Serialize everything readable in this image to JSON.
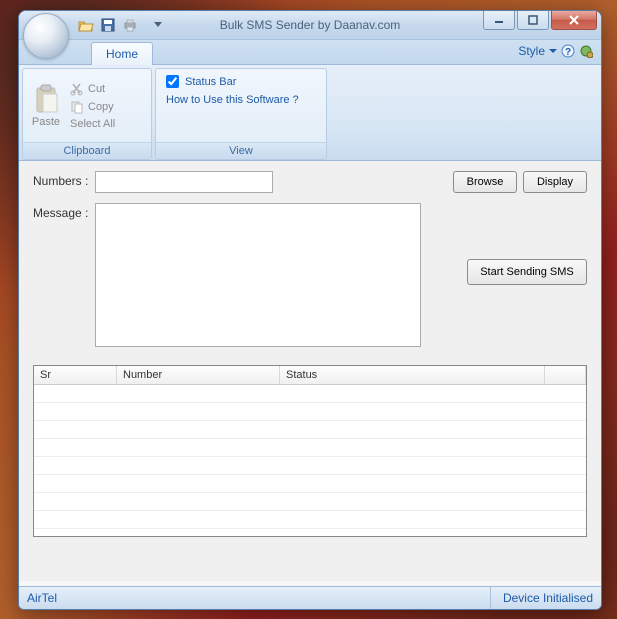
{
  "title": "Bulk SMS Sender by Daanav.com",
  "style_label": "Style",
  "tabs": {
    "home": "Home"
  },
  "ribbon": {
    "clipboard": {
      "label": "Clipboard",
      "paste": "Paste",
      "cut": "Cut",
      "copy": "Copy",
      "select_all": "Select All"
    },
    "view": {
      "label": "View",
      "status_bar": "Status Bar",
      "howto": "How to Use this Software ?"
    }
  },
  "form": {
    "numbers_label": "Numbers :",
    "message_label": "Message :",
    "numbers_value": "",
    "message_value": "",
    "browse": "Browse",
    "display": "Display",
    "start": "Start Sending SMS"
  },
  "table": {
    "cols": {
      "sr": "Sr",
      "number": "Number",
      "status": "Status"
    }
  },
  "status": {
    "left": "AirTel",
    "right": "Device Initialised"
  }
}
